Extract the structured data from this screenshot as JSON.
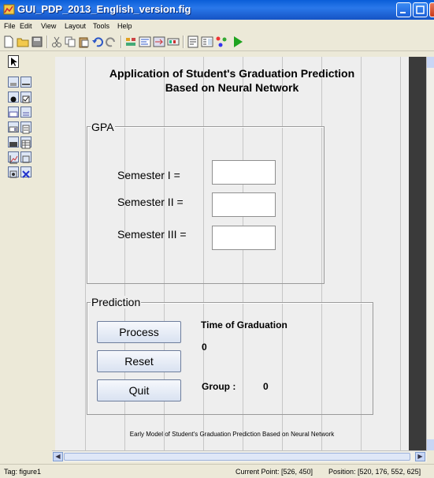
{
  "window": {
    "title": "GUI_PDP_2013_English_version.fig"
  },
  "menu": [
    "File",
    "Edit",
    "View",
    "Layout",
    "Tools",
    "Help"
  ],
  "canvas": {
    "title_line1": "Application of Student's Graduation Prediction",
    "title_line2": "Based on Neural Network",
    "gpa_panel": {
      "title": "GPA",
      "sem1_label": "Semester I =",
      "sem2_label": "Semester II =",
      "sem3_label": "Semester III =",
      "sem1_value": "",
      "sem2_value": "",
      "sem3_value": ""
    },
    "prediction_panel": {
      "title": "Prediction",
      "process_label": "Process",
      "reset_label": "Reset",
      "quit_label": "Quit",
      "time_label": "Time of Graduation",
      "time_value": "0",
      "group_label": "Group :",
      "group_value": "0"
    },
    "footer": "Early Model of Student's Graduation Prediction  Based on Neural Network"
  },
  "status": {
    "tag": "Tag: figure1",
    "current_point": "Current Point:  [526, 450]",
    "position": "Position: [520, 176, 552, 625]"
  },
  "icons": [
    "figure-icon",
    "new-icon",
    "open-icon",
    "save-icon",
    "cut-icon",
    "copy-icon",
    "paste-icon",
    "undo-icon",
    "redo-icon",
    "align-icon",
    "menu-editor-icon",
    "tab-order-icon",
    "toolbar-editor-icon",
    "m-file-editor-icon",
    "property-inspector-icon",
    "object-browser-icon",
    "run-icon"
  ],
  "colors": {
    "title_bar": "#1553c4",
    "canvas_bg": "#eeeeee",
    "button_bg": "#d9e2f1",
    "run_green": "#1fa31f"
  }
}
